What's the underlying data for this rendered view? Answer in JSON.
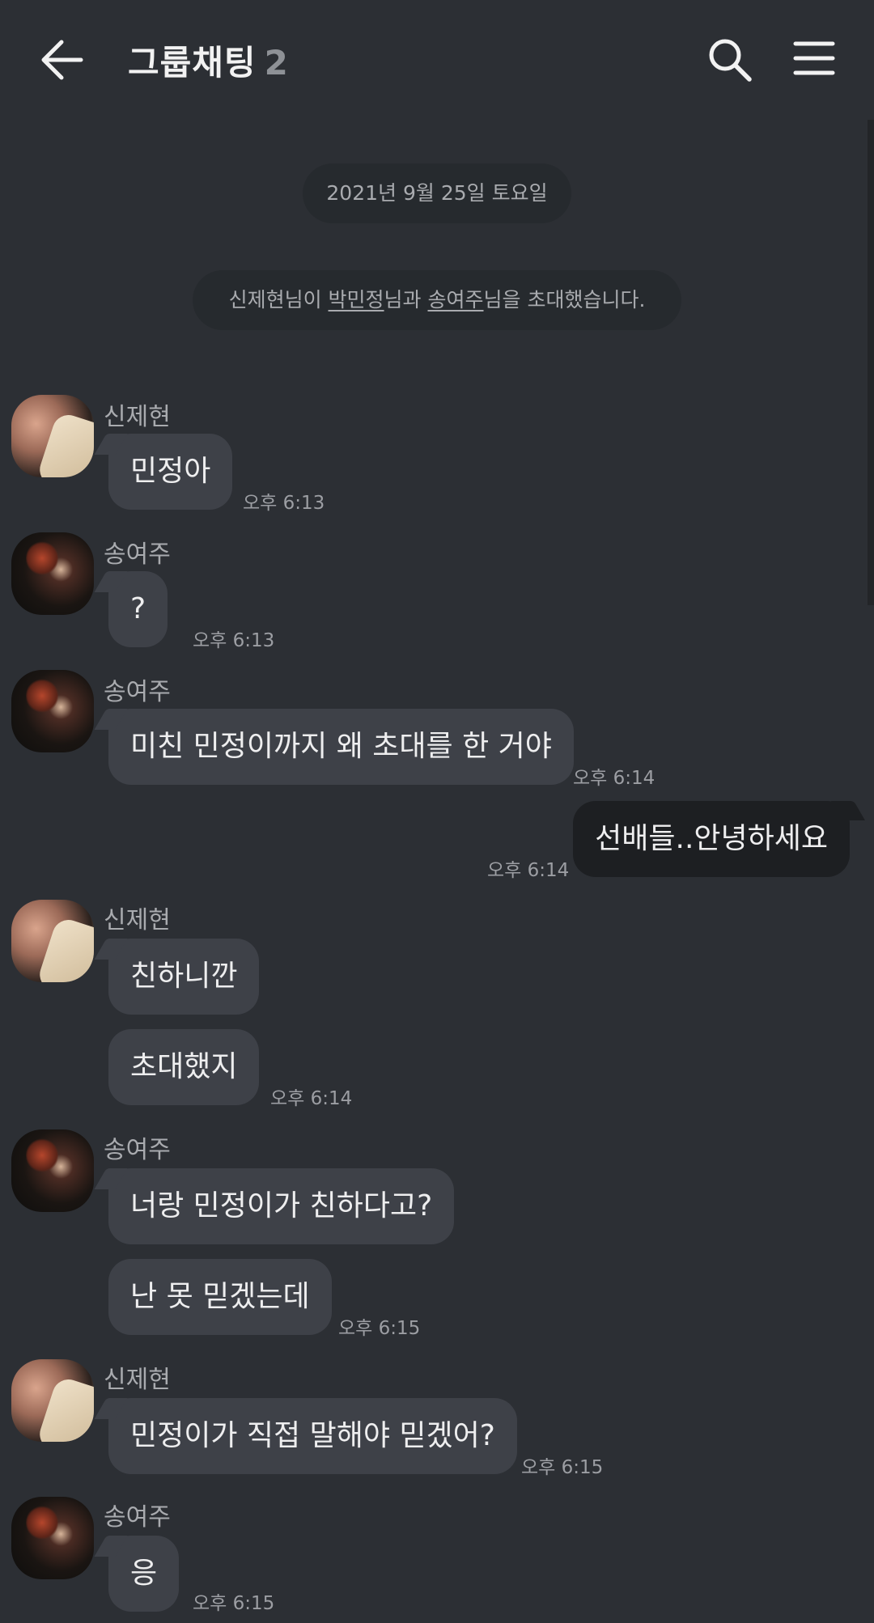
{
  "header": {
    "title": "그룹채팅",
    "member_count": "2"
  },
  "date_divider": "2021년 9월 25일 토요일",
  "system_message": {
    "prefix": "신제현님이 ",
    "user1": "박민정",
    "middle": "님과 ",
    "user2": "송여주",
    "suffix": "님을 초대했습니다."
  },
  "messages": [
    {
      "sender": "신제현",
      "text": "민정아",
      "time": "오후 6:13"
    },
    {
      "sender": "송여주",
      "text": "?",
      "time": "오후 6:13"
    },
    {
      "sender": "송여주",
      "text": "미친 민정이까지 왜 초대를 한 거야",
      "time": "오후 6:14"
    },
    {
      "sender": "me",
      "text": "선배들..안녕하세요",
      "time": "오후 6:14"
    },
    {
      "sender": "신제현",
      "text": "친하니깐",
      "time": ""
    },
    {
      "sender": "신제현",
      "text": "초대했지",
      "time": "오후 6:14"
    },
    {
      "sender": "송여주",
      "text": "너랑 민정이가 친하다고?",
      "time": ""
    },
    {
      "sender": "송여주",
      "text": "난 못 믿겠는데",
      "time": "오후 6:15"
    },
    {
      "sender": "신제현",
      "text": "민정이가 직접 말해야 믿겠어?",
      "time": "오후 6:15"
    },
    {
      "sender": "송여주",
      "text": "응",
      "time": "오후 6:15"
    }
  ],
  "icons": {
    "back": "arrow-left-icon",
    "search": "search-icon",
    "menu": "hamburger-menu-icon"
  }
}
